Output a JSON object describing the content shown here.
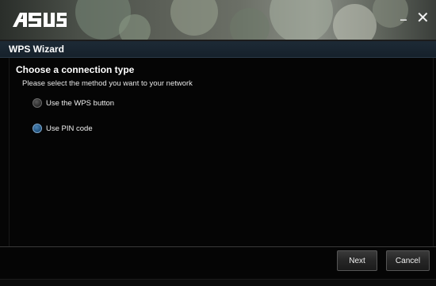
{
  "titlebar": {
    "logo_text": "ASUS",
    "minimize_glyph": "–",
    "close_glyph": "✕"
  },
  "wizard": {
    "title": "WPS Wizard",
    "heading": "Choose a connection type",
    "description": "Please select the method you want to your network"
  },
  "options": [
    {
      "label": "Use the WPS button",
      "selected": false
    },
    {
      "label": "Use PIN code",
      "selected": true
    }
  ],
  "footer": {
    "next_label": "Next",
    "cancel_label": "Cancel"
  },
  "colors": {
    "header_bg": "#1d2a36",
    "selected_radio": "#245683",
    "window_bg": "#050505"
  }
}
